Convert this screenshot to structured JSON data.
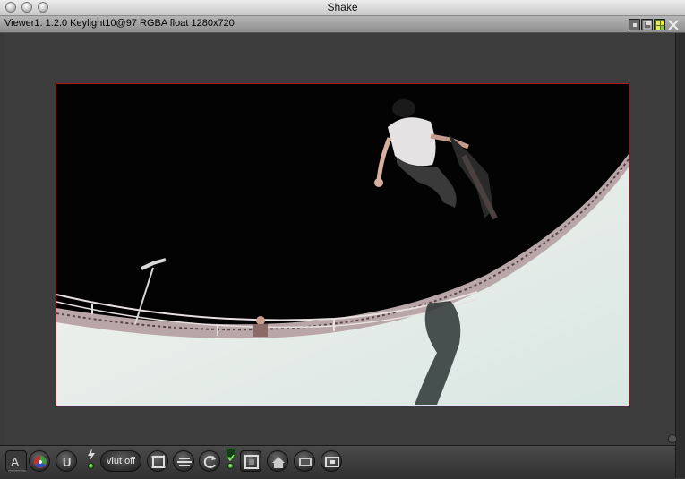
{
  "window": {
    "title": "Shake"
  },
  "viewer": {
    "title": "Viewer1: 1:2.0 Keylight10@97 RGBA float 1280x720",
    "image_description_icon": "skateboarder-bowl-image"
  },
  "toolbar": {
    "vlut_label": "vlut off",
    "channel_label": "A"
  },
  "colors": {
    "frame_border": "#b01820",
    "led": "#2e8a1a"
  }
}
